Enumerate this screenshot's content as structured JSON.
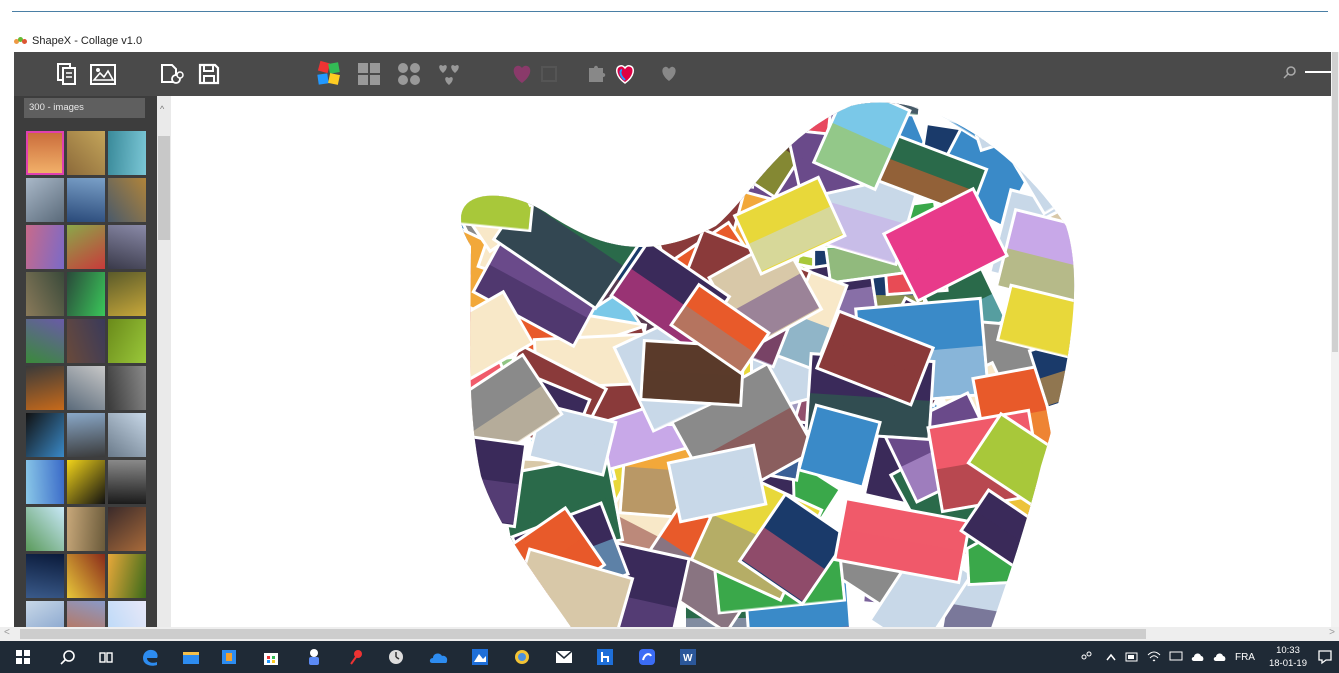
{
  "window": {
    "title": "ShapeX - Collage v1.0"
  },
  "toolbar": {
    "file_buttons": [
      {
        "name": "copy-images-button",
        "icon": "copy-icon"
      },
      {
        "name": "add-images-button",
        "icon": "image-gallery-icon"
      },
      {
        "name": "open-shape-button",
        "icon": "open-shape-icon"
      },
      {
        "name": "save-button",
        "icon": "save-icon"
      }
    ],
    "layout_buttons": [
      "colorful-layout-icon",
      "grid-layout-icon",
      "circles-layout-icon",
      "hearts-layout-icon"
    ],
    "shape_buttons": [
      "heart-shape-icon",
      "square-shape-icon",
      "puzzle-shape-icon",
      "heart-outline-icon",
      "heart-small-icon"
    ],
    "search_icon": "search-icon",
    "zoom_icon": "zoom-slider-icon"
  },
  "sidebar": {
    "image_count": "300 - images",
    "thumbnail_rows": 11,
    "thumbnail_cols": 3
  },
  "taskbar": {
    "apps": [
      "windows-start-icon",
      "search-icon",
      "task-view-icon",
      "edge-icon",
      "file-explorer-icon",
      "media-icon",
      "store-icon",
      "app-icon",
      "pin-icon",
      "clock-app-icon",
      "onedrive-icon",
      "photos-icon",
      "app2-icon",
      "mail-icon",
      "houzz-icon",
      "app3-icon",
      "word-icon"
    ],
    "language": "FRA",
    "time": "10:33",
    "date": "18-01-19"
  },
  "colors": {
    "toolbar_bg": "#4a4a4a",
    "sidebar_bg": "#3d3d3d",
    "accent_selected": "#e040b0",
    "taskbar_bg": "#1f2a36"
  }
}
